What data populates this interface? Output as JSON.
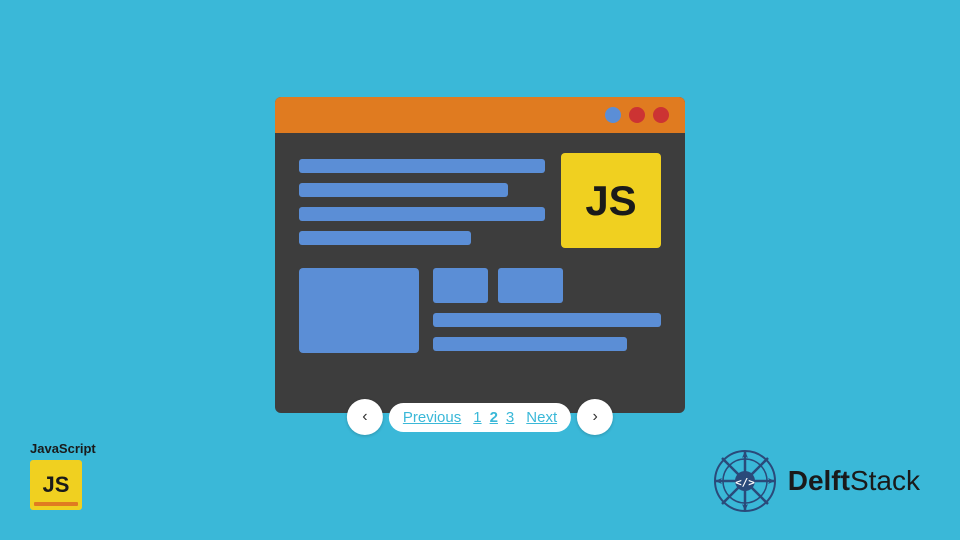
{
  "browser": {
    "titlebar": {
      "dots": [
        {
          "color": "blue",
          "class": "dot-blue"
        },
        {
          "color": "red",
          "class": "dot-red1"
        },
        {
          "color": "red",
          "class": "dot-red2"
        }
      ]
    },
    "js_badge_label": "JS"
  },
  "pagination": {
    "previous_label": "Previous",
    "next_label": "Next",
    "pages": [
      "1",
      "2",
      "3"
    ]
  },
  "js_logo": {
    "title": "JavaScript",
    "badge": "JS"
  },
  "delftstack": {
    "name_part1": "Delft",
    "name_part2": "Stack"
  }
}
